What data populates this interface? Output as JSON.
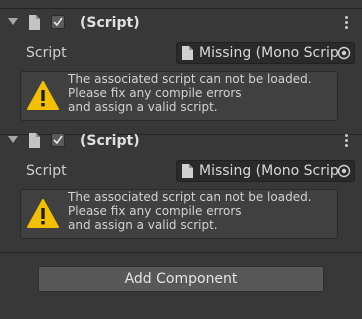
{
  "components": [
    {
      "title": "(Script)",
      "enabled": true,
      "field_label": "Script",
      "field_value": "Missing (Mono Script)",
      "help_lines": [
        "The associated script can not be loaded.",
        "Please fix any compile errors",
        "and assign a valid script."
      ]
    },
    {
      "title": "(Script)",
      "enabled": true,
      "field_label": "Script",
      "field_value": "Missing (Mono Script)",
      "help_lines": [
        "The associated script can not be loaded.",
        "Please fix any compile errors",
        "and assign a valid script."
      ]
    }
  ],
  "add_component_label": "Add Component",
  "colors": {
    "background": "#383838",
    "warning": "#f3c000"
  },
  "icons": [
    "foldout-arrow-icon",
    "script-file-icon",
    "checkmark-icon",
    "kebab-menu-icon",
    "object-picker-icon",
    "warning-icon"
  ]
}
